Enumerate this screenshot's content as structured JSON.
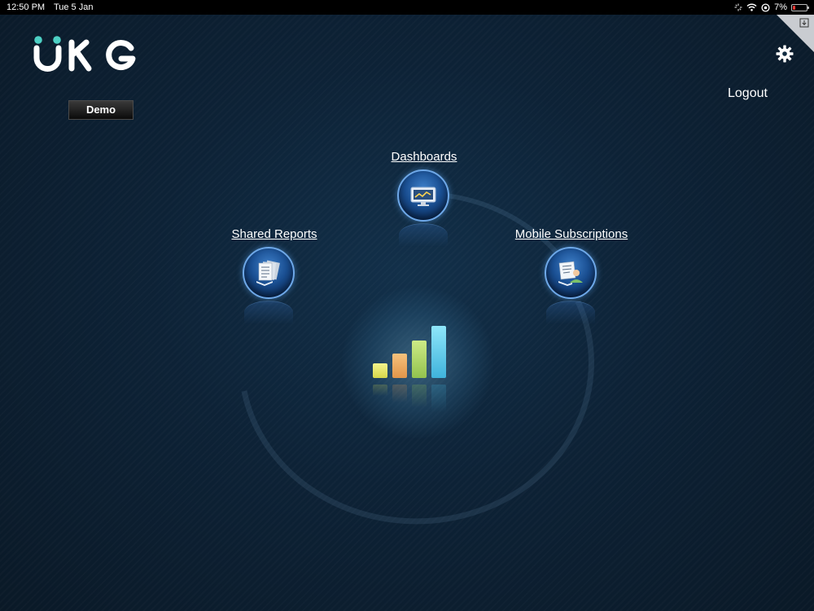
{
  "status_bar": {
    "time": "12:50 PM",
    "date": "Tue 5 Jan",
    "battery": "7%"
  },
  "brand": {
    "logo_text": "UKG",
    "accent_color": "#4dd0c4"
  },
  "header": {
    "demo_label": "Demo",
    "logout_label": "Logout"
  },
  "nav": {
    "dashboards": {
      "label": "Dashboards",
      "icon": "dashboard-monitor-icon"
    },
    "shared_reports": {
      "label": "Shared Reports",
      "icon": "reports-stack-icon"
    },
    "mobile_subscriptions": {
      "label": "Mobile Subscriptions",
      "icon": "subscription-user-icon"
    }
  },
  "center_graphic": {
    "icon": "bar-chart-icon",
    "bar_colors": [
      "#e8e86a",
      "#f2b266",
      "#b8e06a",
      "#6cd4f2"
    ]
  }
}
